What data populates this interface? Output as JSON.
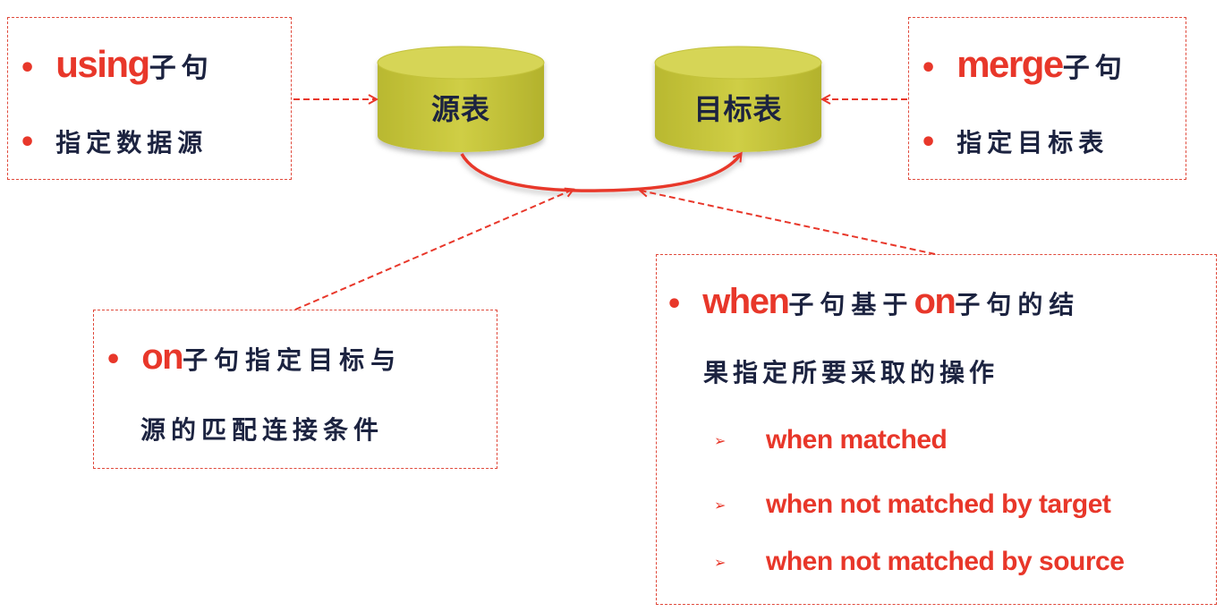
{
  "colors": {
    "accent": "#e8372a",
    "text": "#1c2340",
    "cylinder": "#c5c43a",
    "cylinder_top": "#d8d75c"
  },
  "source_table": {
    "label": "源表"
  },
  "target_table": {
    "label": "目标表"
  },
  "using_box": {
    "keyword": "using",
    "suffix": "子句",
    "line2": "指定数据源"
  },
  "merge_box": {
    "keyword": "merge",
    "suffix": "子句",
    "line2": "指定目标表"
  },
  "on_box": {
    "keyword": "on",
    "suffix": "子句指定目标与",
    "line2": "源的匹配连接条件"
  },
  "when_box": {
    "keyword": "when",
    "mid": "子句基于",
    "keyword2": "on",
    "suffix": "子句的结",
    "line2": "果指定所要采取的操作",
    "items": [
      "when matched",
      "when not matched by target",
      "when not matched by source"
    ]
  },
  "icons": {
    "bullet": "•",
    "sub_bullet": "➢"
  }
}
